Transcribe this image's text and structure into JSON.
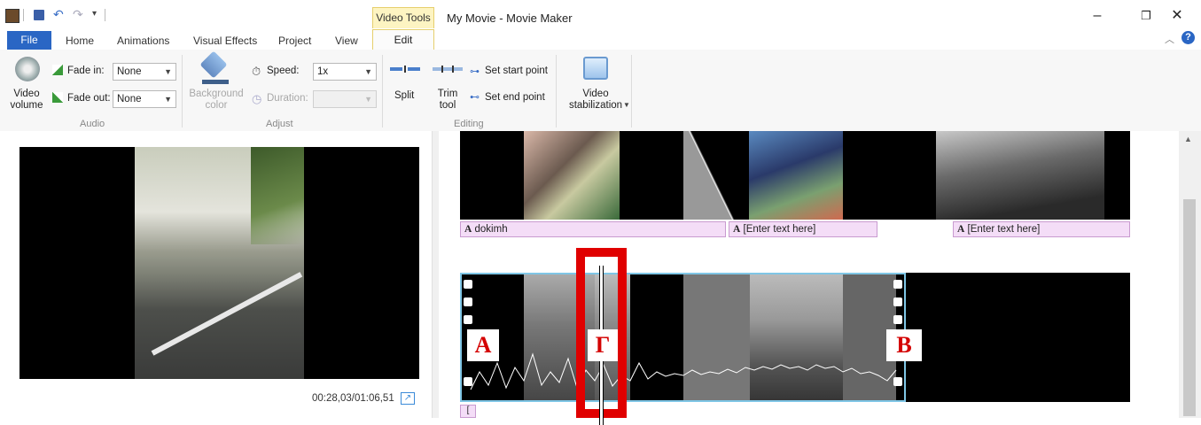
{
  "window": {
    "title": "My Movie - Movie Maker",
    "contextual_tab": "Video Tools",
    "minimize": "–",
    "restore": "❐",
    "close": "✕"
  },
  "tabs": [
    "File",
    "Home",
    "Animations",
    "Visual Effects",
    "Project",
    "View",
    "Edit"
  ],
  "active_tab": "Edit",
  "ribbon": {
    "audio": {
      "group": "Audio",
      "video_volume": "Video volume",
      "fade_in_label": "Fade in:",
      "fade_in_value": "None",
      "fade_out_label": "Fade out:",
      "fade_out_value": "None"
    },
    "adjust": {
      "group": "Adjust",
      "background_color": "Background color",
      "speed_label": "Speed:",
      "speed_value": "1x",
      "duration_label": "Duration:"
    },
    "editing": {
      "group": "Editing",
      "split": "Split",
      "trim_tool": "Trim tool",
      "set_start_point": "Set start point",
      "set_end_point": "Set end point"
    },
    "stabilization": {
      "video_stabilization": "Video stabilization"
    }
  },
  "preview": {
    "timecode": "00:28,03/01:06,51"
  },
  "storyboard": {
    "captions": [
      "dokimh",
      "[Enter text here]",
      "[Enter text here]"
    ],
    "markers": {
      "left": "A",
      "playhead": "Γ",
      "right": "B"
    }
  },
  "colors": {
    "file_tab": "#2a66c4",
    "caption_bg": "#f4ddf7",
    "marker_red": "#d40000",
    "contextual_tab": "#fdf4c2"
  }
}
